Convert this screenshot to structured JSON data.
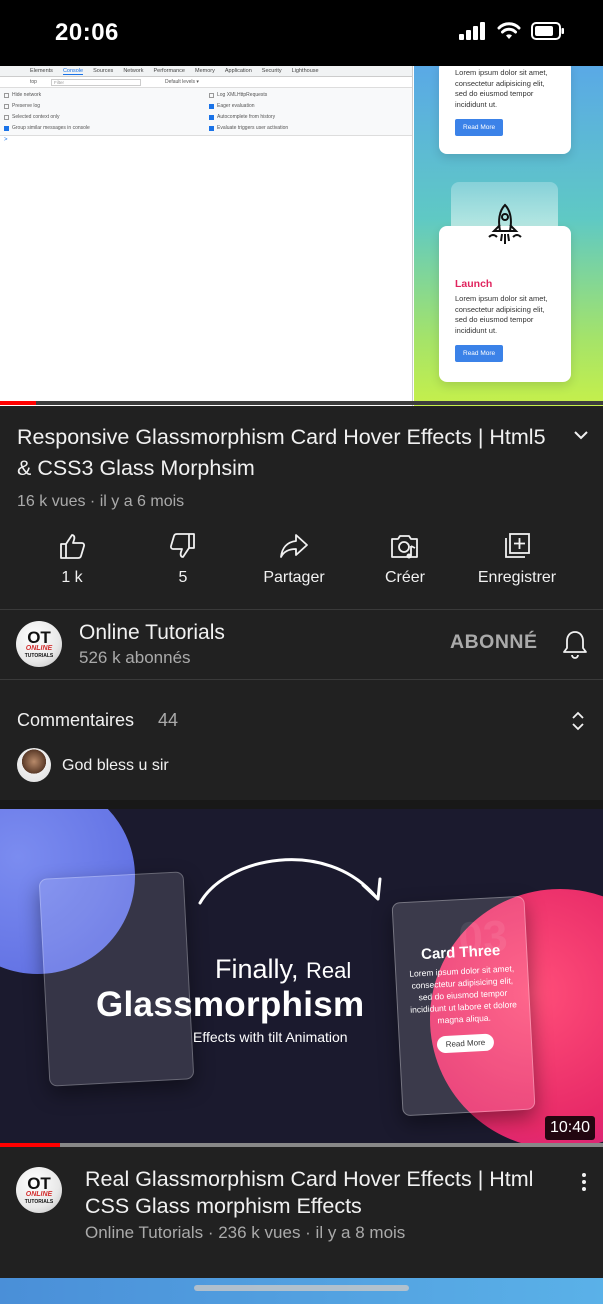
{
  "status_bar": {
    "time": "20:06"
  },
  "player": {
    "devtools": {
      "tabs": [
        "Elements",
        "Console",
        "Sources",
        "Network",
        "Performance",
        "Memory",
        "Application",
        "Security",
        "Lighthouse"
      ],
      "active_tab": "Console",
      "context": "top",
      "filter_placeholder": "Filter",
      "levels": "Default levels ▾",
      "options": [
        {
          "label": "Hide network",
          "checked": false
        },
        {
          "label": "Log XMLHttpRequests",
          "checked": false
        },
        {
          "label": "Preserve log",
          "checked": false
        },
        {
          "label": "Eager evaluation",
          "checked": true
        },
        {
          "label": "Selected context only",
          "checked": false
        },
        {
          "label": "Autocomplete from history",
          "checked": true
        },
        {
          "label": "Group similar messages in console",
          "checked": true
        },
        {
          "label": "Evaluate triggers user activation",
          "checked": true
        }
      ],
      "prompt": ">"
    },
    "preview": {
      "card1_text": "Lorem ipsum dolor sit amet, consectetur adipisicing elit, sed do eiusmod tempor incididunt ut.",
      "card1_button": "Read More",
      "card2_title": "Launch",
      "card2_text": "Lorem ipsum dolor sit amet, consectetur adipisicing elit, sed do eiusmod tempor incididunt ut.",
      "card2_button": "Read More"
    },
    "progress": 0.06
  },
  "video": {
    "title": "Responsive Glassmorphism Card Hover Effects | Html5 & CSS3 Glass Morphsim",
    "meta": "16 k vues · il y a 6 mois"
  },
  "actions": {
    "like": "1 k",
    "dislike": "5",
    "share": "Partager",
    "create": "Créer",
    "save": "Enregistrer"
  },
  "channel": {
    "logo_top": "OT",
    "logo_mid": "ONLINE",
    "logo_bottom": "TUTORIALS",
    "name": "Online Tutorials",
    "subscribers": "526 k abonnés",
    "subscribe_state": "ABONNÉ"
  },
  "comments": {
    "title": "Commentaires",
    "count": "44",
    "first_comment": "God bless u sir"
  },
  "next_video": {
    "thumbnail": {
      "card_number": "03",
      "card_title": "Card Three",
      "card_body": "Lorem ipsum dolor sit amet, consectetur adipisicing elit, sed do eiusmod tempor incididunt ut labore et dolore magna aliqua.",
      "card_button": "Read More",
      "line1": "Finally,",
      "line1b": "Real",
      "line2": "Glassmorphism",
      "line3": "Effects with tilt Animation",
      "duration": "10:40",
      "progress": 0.1
    },
    "title": "Real Glassmorphism Card Hover Effects | Html CSS Glass morphism  Effects",
    "meta": "Online Tutorials · 236 k vues · il y a 8 mois"
  },
  "colors": {
    "background": "#212121",
    "progress_red": "#ff0000",
    "accent_pink": "#e0245e",
    "button_blue": "#3b82e8"
  }
}
